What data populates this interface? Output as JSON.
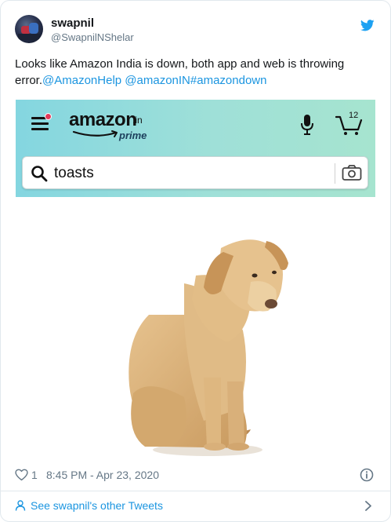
{
  "tweet": {
    "author": {
      "display_name": "swapnil",
      "handle": "@SwapnilNShelar"
    },
    "text": {
      "body": "Looks like Amazon India is down, both app and web is throwing error.",
      "mention_1": "@AmazonHelp",
      "mention_2": "@amazonIN",
      "hashtag": "#amazondown"
    },
    "likes": "1",
    "timestamp": "8:45 PM - Apr 23, 2020",
    "footer_link": "See swapnil's other Tweets"
  },
  "screenshot": {
    "logo": {
      "word": "amazon",
      "suffix": ".in",
      "sub": "prime"
    },
    "cart_count": "12",
    "search_value": "toasts"
  },
  "colors": {
    "link": "#1b95e0",
    "meta_text": "#657786",
    "appbar_start": "#84d6e0",
    "appbar_end": "#a6e4cf",
    "twitter_blue": "#1da1f2"
  },
  "icons": {
    "brand": "twitter-bird-icon",
    "like": "heart-icon",
    "info": "info-icon",
    "footer": "person-icon",
    "footer_arrow": "chevron-right-icon"
  }
}
